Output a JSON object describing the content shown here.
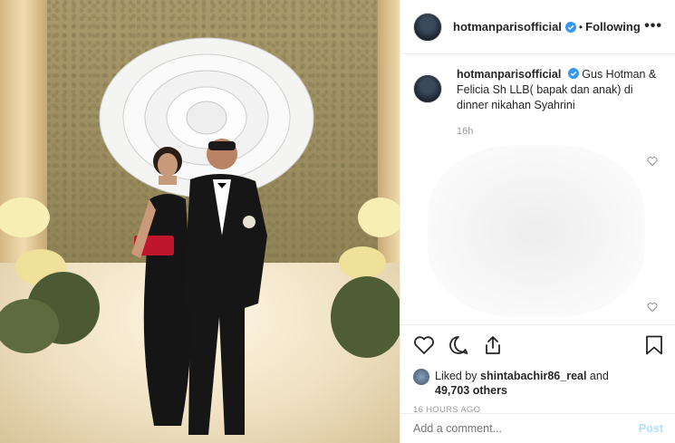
{
  "post": {
    "username": "hotmanparisofficial",
    "separator": "•",
    "follow_status": "Following",
    "more_label": "•••"
  },
  "caption": {
    "username": "hotmanparisofficial",
    "text": "Gus Hotman & Felicia Sh LLB( bapak dan anak) di dinner nikahan Syahrini",
    "time": "16h"
  },
  "likes": {
    "prefix": "Liked by ",
    "user": "shintabachir86_real",
    "middle": " and",
    "count": "49,703 others"
  },
  "timestamp": "16 HOURS AGO",
  "comment": {
    "placeholder": "Add a comment...",
    "post_label": "Post"
  },
  "icons": {
    "verified": "verified-badge-icon",
    "heart": "heart-icon",
    "comment": "comment-icon",
    "share": "share-icon",
    "bookmark": "bookmark-icon"
  },
  "colors": {
    "verified": "#3897f0",
    "post_disabled": "#b2dffc",
    "muted": "#999999"
  }
}
